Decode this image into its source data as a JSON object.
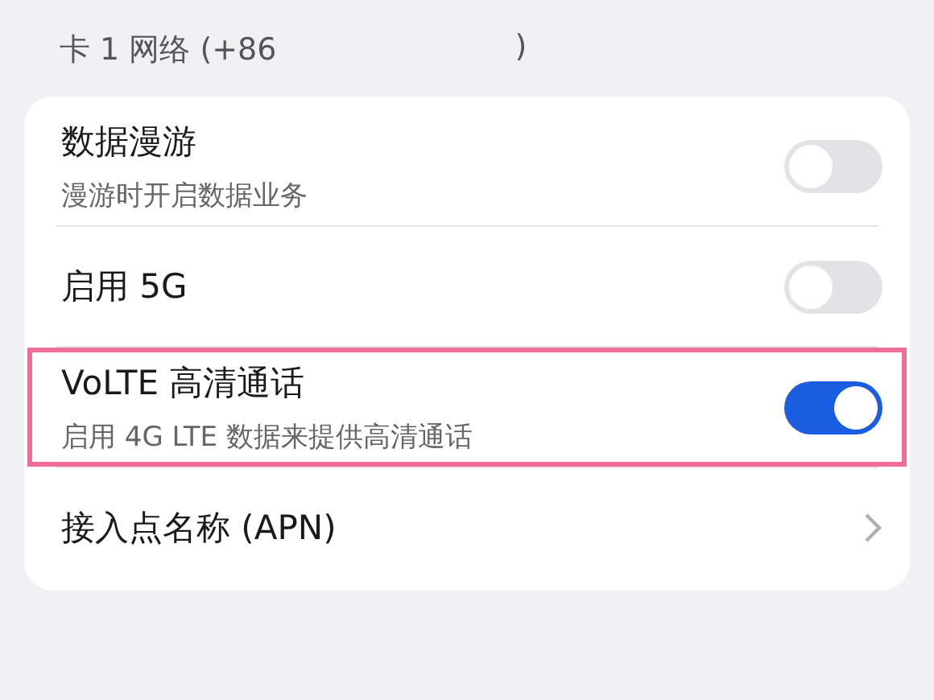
{
  "section_header": {
    "label": "卡 1 网络 (+86",
    "closing": ")"
  },
  "settings": [
    {
      "kind": "toggle",
      "title": "数据漫游",
      "subtitle": "漫游时开启数据业务",
      "on": false,
      "highlighted": false
    },
    {
      "kind": "toggle",
      "title": "启用 5G",
      "on": false,
      "highlighted": false
    },
    {
      "kind": "toggle",
      "title": "VoLTE 高清通话",
      "subtitle": "启用 4G LTE 数据来提供高清通话",
      "on": true,
      "highlighted": true
    },
    {
      "kind": "link",
      "title": "接入点名称 (APN)",
      "highlighted": false
    }
  ]
}
